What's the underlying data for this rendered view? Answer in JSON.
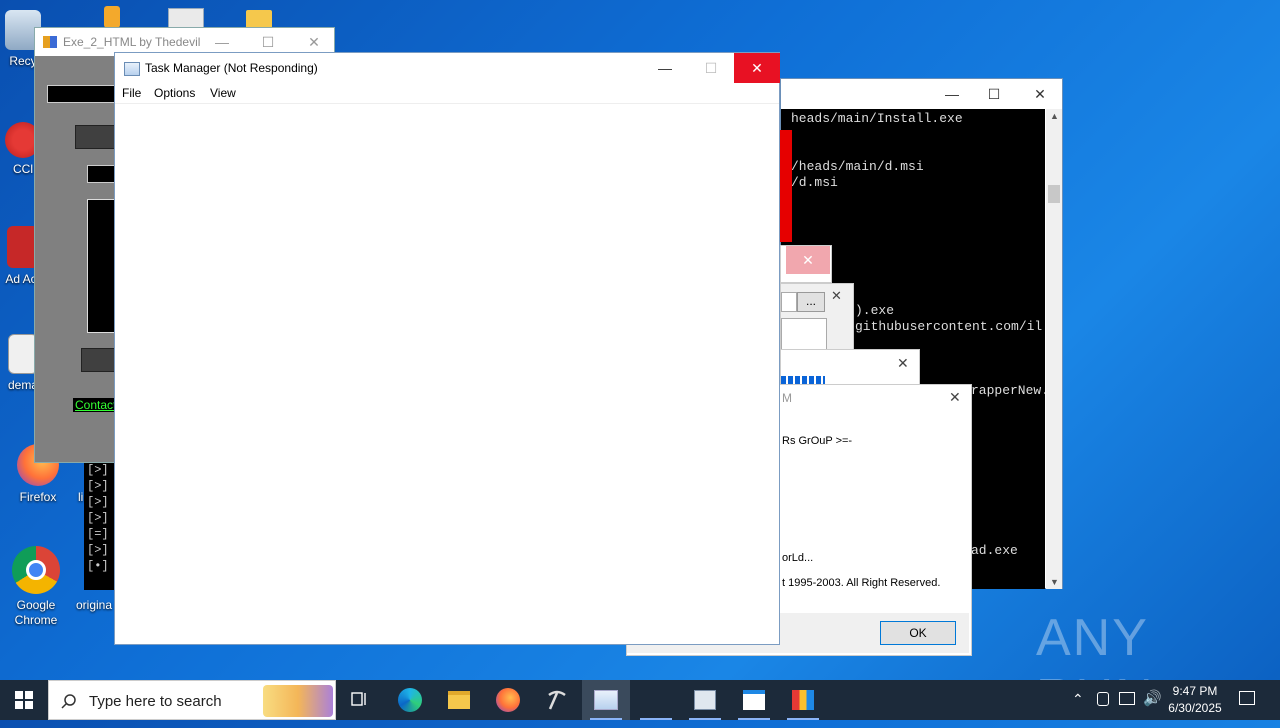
{
  "desktop": {
    "icons": [
      {
        "label": "Recy",
        "name": "recycle-bin-icon"
      },
      {
        "label": "CCl",
        "name": "ccleaner-icon"
      },
      {
        "label": "Ad Acr",
        "name": "adobe-acrobat-icon"
      },
      {
        "label": "dema",
        "name": "dema-file-icon"
      },
      {
        "label": "Firefox",
        "name": "firefox-icon"
      },
      {
        "label": "Google Chrome",
        "name": "chrome-icon"
      },
      {
        "label": "origina",
        "name": "original-file-icon"
      },
      {
        "label": "li",
        "name": "li-file-icon"
      }
    ],
    "watermark": "ANY RUN"
  },
  "exe2html": {
    "title": "Exe_2_HTML by Thedevil",
    "contact": "Contact"
  },
  "console": {
    "lines": [
      "heads/main/Install.exe",
      "",
      "/heads/main/d.msi",
      "/d.msi",
      "",
      "",
      "",
      "",
      "",
      ").exe",
      "githubusercontent.com/il",
      "",
      "",
      "rapperNew.",
      "",
      "",
      "",
      "",
      "",
      "",
      "",
      "ad.exe"
    ]
  },
  "cmd_left": {
    "lines": [
      "[>]",
      "[>]",
      "[>]",
      "[>]",
      "[=]",
      "[>]",
      "[•]"
    ]
  },
  "browse_dialog": {
    "browse_label": "..."
  },
  "about_dialog": {
    "title_fragment": "M",
    "group_text": "Rs GrOuP >=-",
    "world_text": "orLd...",
    "copyright": "t 1995-2003. All Right Reserved.",
    "ok_label": "OK"
  },
  "task_manager": {
    "title": "Task Manager (Not Responding)",
    "menu": [
      "File",
      "Options",
      "View"
    ]
  },
  "taskbar": {
    "search_placeholder": "Type here to search",
    "time": "9:47 PM",
    "date": "6/30/2025"
  },
  "colors": {
    "close_red": "#e81123",
    "console_bg": "#000000",
    "taskbar_bg": "#1c2a3a"
  }
}
